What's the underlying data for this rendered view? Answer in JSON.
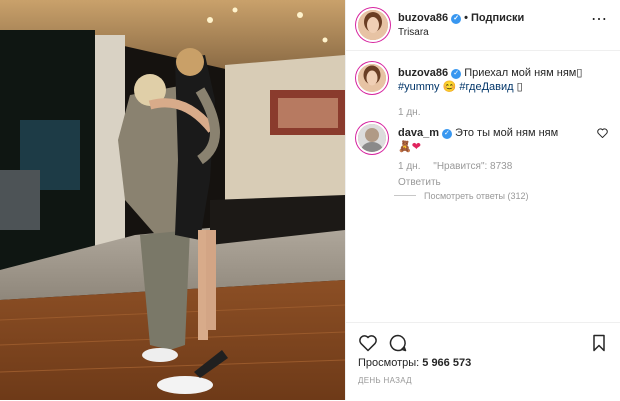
{
  "header": {
    "username": "buzova86",
    "dot": "•",
    "follow_label": "Подписки",
    "location": "Trisara",
    "more_icon": "more-options-icon"
  },
  "caption": {
    "username": "buzova86",
    "text": "Приехал мой ням ням",
    "emoji_box": "▯",
    "hashtag1": "#yummy",
    "emoji_smile": "😊",
    "hashtag2": "#гдеДавид",
    "emoji_box2": "▯",
    "time": "1 дн."
  },
  "comment": {
    "username": "dava_m",
    "text": "Это ты мой ням ням",
    "emoji_bear": "🧸",
    "emoji_heart": "❤",
    "time": "1 дн.",
    "likes": "\"Нравится\": 8738",
    "reply_label": "Ответить",
    "view_replies": "Посмотреть ответы (312)"
  },
  "actions": {
    "views_label": "Просмотры:",
    "views_count": "5 966 573",
    "date": "ДЕНЬ НАЗАД"
  },
  "colors": {
    "verified": "#3897f0",
    "hashtag": "#003569",
    "meta": "#999999"
  }
}
